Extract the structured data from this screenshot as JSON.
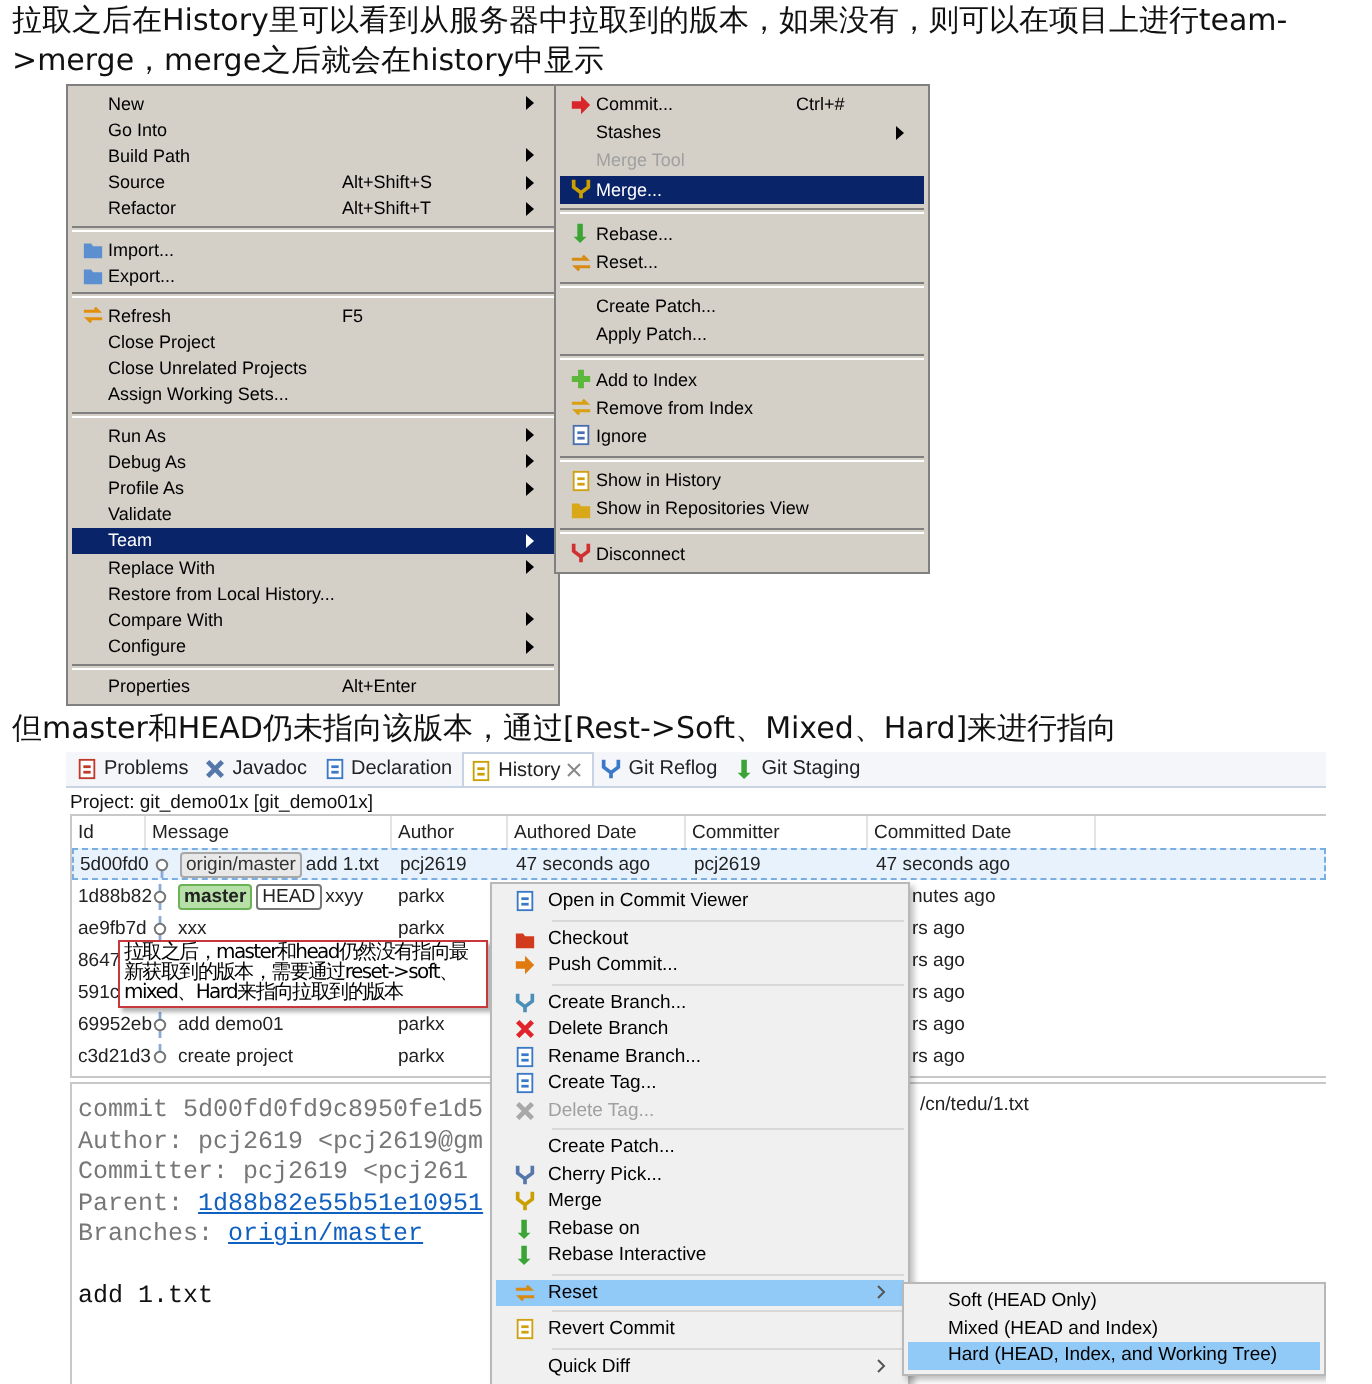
{
  "intro_text": "拉取之后在History里可以看到从服务器中拉取到的版本，如果没有，则可以在项目上进行team->merge，merge之后就会在history中显示",
  "project_menu": {
    "groups": [
      [
        {
          "label": "New",
          "submenu": true,
          "selected": false
        },
        {
          "label": "Go Into",
          "selected": false
        },
        {
          "label": "Build Path",
          "submenu": true,
          "selected": false
        },
        {
          "label": "Source",
          "shortcut": "Alt+Shift+S",
          "submenu": true,
          "selected": false
        },
        {
          "label": "Refactor",
          "shortcut": "Alt+Shift+T",
          "submenu": true,
          "selected": false
        }
      ],
      [
        {
          "label": "Import...",
          "selected": false
        },
        {
          "label": "Export...",
          "selected": false
        }
      ],
      [
        {
          "label": "Refresh",
          "shortcut": "F5",
          "selected": false
        },
        {
          "label": "Close Project",
          "selected": false
        },
        {
          "label": "Close Unrelated Projects",
          "selected": false
        },
        {
          "label": "Assign Working Sets...",
          "selected": false
        }
      ],
      [
        {
          "label": "Run As",
          "submenu": true,
          "selected": false
        },
        {
          "label": "Debug As",
          "submenu": true,
          "selected": false
        },
        {
          "label": "Profile As",
          "submenu": true,
          "selected": false
        },
        {
          "label": "Validate",
          "selected": false
        },
        {
          "label": "Team",
          "submenu": true,
          "selected": true
        },
        {
          "label": "Replace With",
          "submenu": true,
          "selected": false
        },
        {
          "label": "Restore from Local History...",
          "selected": false
        },
        {
          "label": "Compare With",
          "submenu": true,
          "selected": false
        },
        {
          "label": "Configure",
          "submenu": true,
          "selected": false
        }
      ],
      [
        {
          "label": "Properties",
          "shortcut": "Alt+Enter",
          "selected": false
        }
      ]
    ]
  },
  "team_menu": {
    "groups": [
      [
        {
          "label": "Commit...",
          "shortcut": "Ctrl+#",
          "selected": false
        },
        {
          "label": "Stashes",
          "submenu": true,
          "selected": false
        },
        {
          "label": "Merge Tool",
          "disabled": true,
          "selected": false
        },
        {
          "label": "Merge...",
          "selected": true
        }
      ],
      [
        {
          "label": "Rebase...",
          "selected": false
        },
        {
          "label": "Reset...",
          "selected": false
        }
      ],
      [
        {
          "label": "Create Patch...",
          "selected": false
        },
        {
          "label": "Apply Patch...",
          "selected": false
        }
      ],
      [
        {
          "label": "Add to Index",
          "selected": false
        },
        {
          "label": "Remove from Index",
          "selected": false
        },
        {
          "label": "Ignore",
          "selected": false
        }
      ],
      [
        {
          "label": "Show in History",
          "selected": false
        },
        {
          "label": "Show in Repositories View",
          "selected": false
        }
      ],
      [
        {
          "label": "Disconnect",
          "selected": false
        }
      ]
    ]
  },
  "caption_text": "但master和HEAD仍未指向该版本，通过[Rest->Soft、Mixed、Hard]来进行指向",
  "history_view": {
    "tabs": [
      {
        "label": "Problems",
        "selected": false
      },
      {
        "label": "Javadoc",
        "selected": false
      },
      {
        "label": "Declaration",
        "selected": false
      },
      {
        "label": "History",
        "selected": true
      },
      {
        "label": "Git Reflog",
        "selected": false
      },
      {
        "label": "Git Staging",
        "selected": false
      }
    ],
    "project_label": "Project: git_demo01x [git_demo01x]",
    "columns": [
      "Id",
      "Message",
      "Author",
      "Authored Date",
      "Committer",
      "Committed Date"
    ],
    "rows": [
      {
        "id": "5d00fd0",
        "refs": [
          {
            "name": "origin/master",
            "kind": "remote"
          }
        ],
        "message": "add 1.txt",
        "author": "pcj2619",
        "authored_date": "47 seconds ago",
        "committer": "pcj2619",
        "committed_date": "47 seconds ago",
        "selected": true
      },
      {
        "id": "1d88b82",
        "refs": [
          {
            "name": "master",
            "kind": "local"
          },
          {
            "name": "HEAD",
            "kind": "head"
          }
        ],
        "message": "xxyy",
        "author": "parkx",
        "committed_date": "nutes ago",
        "selected": false
      },
      {
        "id": "ae9fb7d",
        "message": "xxx",
        "author": "parkx",
        "committed_date": "rs ago",
        "selected": false
      },
      {
        "id": "8647",
        "committed_date": "rs ago",
        "selected": false
      },
      {
        "id": "591c",
        "committed_date": "rs ago",
        "selected": false
      },
      {
        "id": "69952eb",
        "message": "add demo01",
        "author": "parkx",
        "committed_date": "rs ago",
        "selected": false
      },
      {
        "id": "c3d21d3",
        "message": "create project",
        "author": "parkx",
        "committed_date": "rs ago",
        "selected": false
      }
    ],
    "annotation": "拉取之后，master和head仍然没有指向最新获取到的版本，需要通过reset->soft、mixed、Hard来指向拉取到的版本",
    "commit_details": [
      {
        "label": "commit",
        "value": "5d00fd0fd9c8950fe1d5",
        "kind": "plain"
      },
      {
        "label": "Author:",
        "value": "pcj2619 <pcj2619@gm",
        "kind": "plain"
      },
      {
        "label": "Committer:",
        "value": "pcj2619 <pcj261",
        "kind": "plain"
      },
      {
        "label": "Parent:",
        "value": "1d88b82e55b51e10951",
        "kind": "link"
      },
      {
        "label": "Branches:",
        "value": "origin/master",
        "kind": "link"
      }
    ],
    "commit_message": "add 1.txt",
    "file_list": [
      "/cn/tedu/1.txt"
    ],
    "context_menu": {
      "groups": [
        [
          {
            "label": "Open in Commit Viewer",
            "selected": false
          }
        ],
        [
          {
            "label": "Checkout",
            "selected": false
          },
          {
            "label": "Push Commit...",
            "selected": false
          }
        ],
        [
          {
            "label": "Create Branch...",
            "selected": false
          },
          {
            "label": "Delete Branch",
            "selected": false
          },
          {
            "label": "Rename Branch...",
            "selected": false
          },
          {
            "label": "Create Tag...",
            "selected": false
          },
          {
            "label": "Delete Tag...",
            "disabled": true,
            "selected": false
          }
        ],
        [
          {
            "label": "Create Patch...",
            "selected": false
          },
          {
            "label": "Cherry Pick...",
            "selected": false
          },
          {
            "label": "Merge",
            "selected": false
          },
          {
            "label": "Rebase on",
            "selected": false
          },
          {
            "label": "Rebase Interactive",
            "selected": false
          }
        ],
        [
          {
            "label": "Reset",
            "submenu": true,
            "selected": true
          }
        ],
        [
          {
            "label": "Revert Commit",
            "selected": false
          }
        ],
        [
          {
            "label": "Quick Diff",
            "submenu": true,
            "selected": false
          }
        ]
      ]
    },
    "reset_menu": {
      "items": [
        {
          "label": "Soft (HEAD Only)",
          "selected": false
        },
        {
          "label": "Mixed (HEAD and Index)",
          "selected": false
        },
        {
          "label": "Hard (HEAD, Index, and Working Tree)",
          "selected": true
        }
      ]
    }
  }
}
